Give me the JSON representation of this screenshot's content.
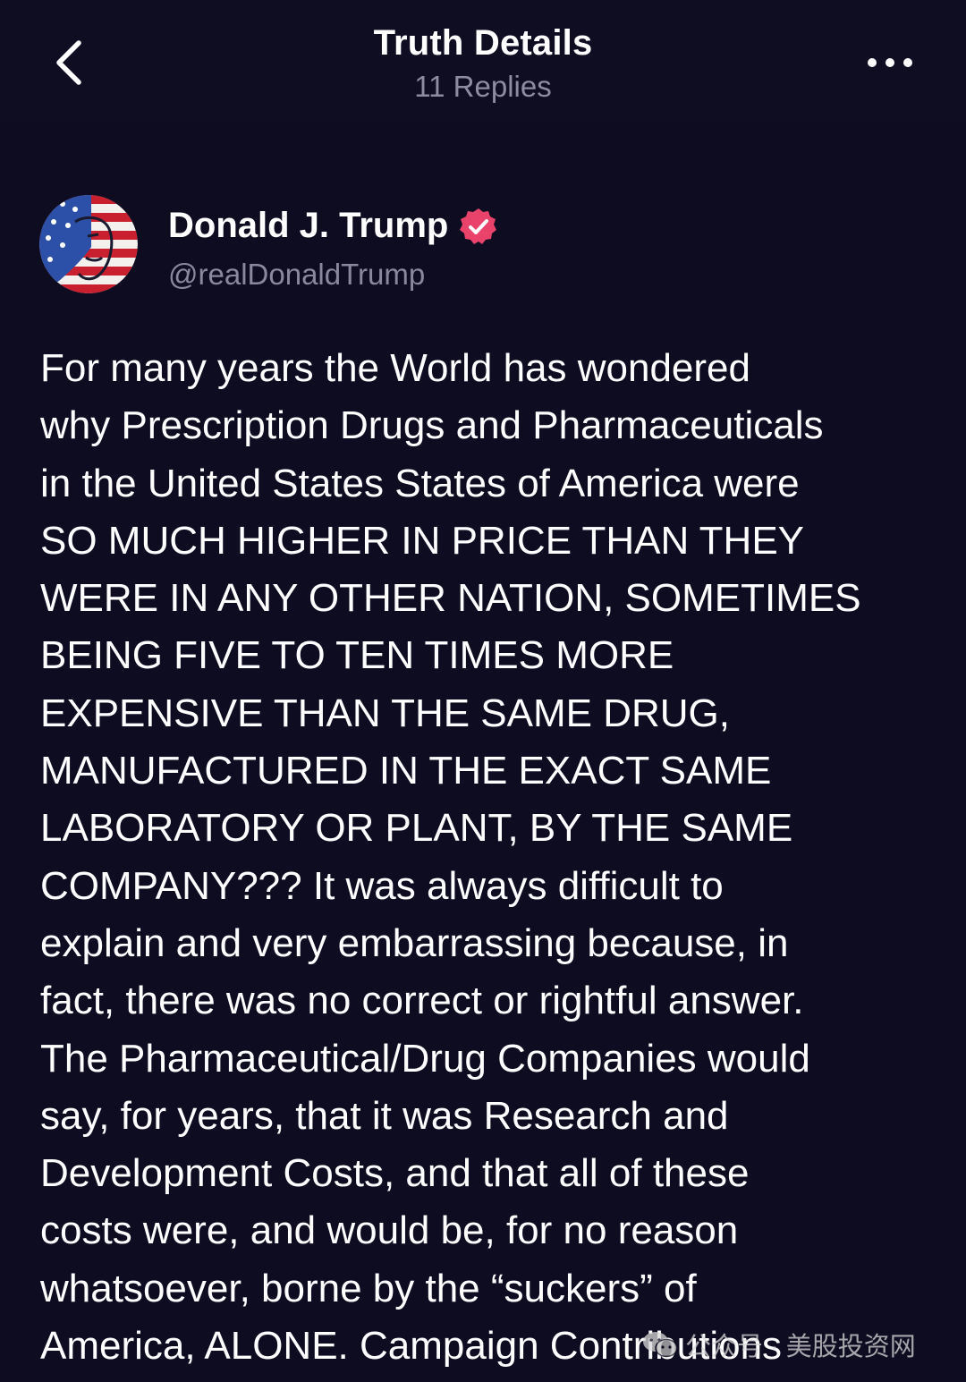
{
  "header": {
    "title": "Truth Details",
    "replies": "11 Replies"
  },
  "post": {
    "author_name": "Donald J. Trump",
    "author_handle": "@realDonaldTrump",
    "verified": true,
    "body": "For many years the World has wondered\nwhy Prescription Drugs and Pharmaceuticals\nin the United States States of America were\nSO MUCH HIGHER IN PRICE THAN THEY\nWERE IN ANY OTHER NATION, SOMETIMES\nBEING FIVE TO TEN TIMES MORE\nEXPENSIVE THAN THE SAME DRUG,\nMANUFACTURED IN THE EXACT SAME\nLABORATORY OR PLANT, BY THE SAME\nCOMPANY??? It was always difficult to\nexplain and very embarrassing because, in\nfact, there was no correct or rightful answer.\nThe Pharmaceutical/Drug Companies would\nsay, for years, that it was Research and\nDevelopment Costs, and that all of these\ncosts were, and would be, for no reason\nwhatsoever, borne by the “suckers” of\nAmerica, ALONE. Campaign Contributions"
  },
  "watermark": {
    "text": "公众号 · 美股投资网"
  },
  "colors": {
    "background": "#0e0c21",
    "verified_badge": "#e9436b",
    "secondary_text": "#8e8ca3"
  },
  "icons": {
    "back": "chevron-left-icon",
    "more": "more-horizontal-icon",
    "verified": "verified-badge-icon"
  }
}
